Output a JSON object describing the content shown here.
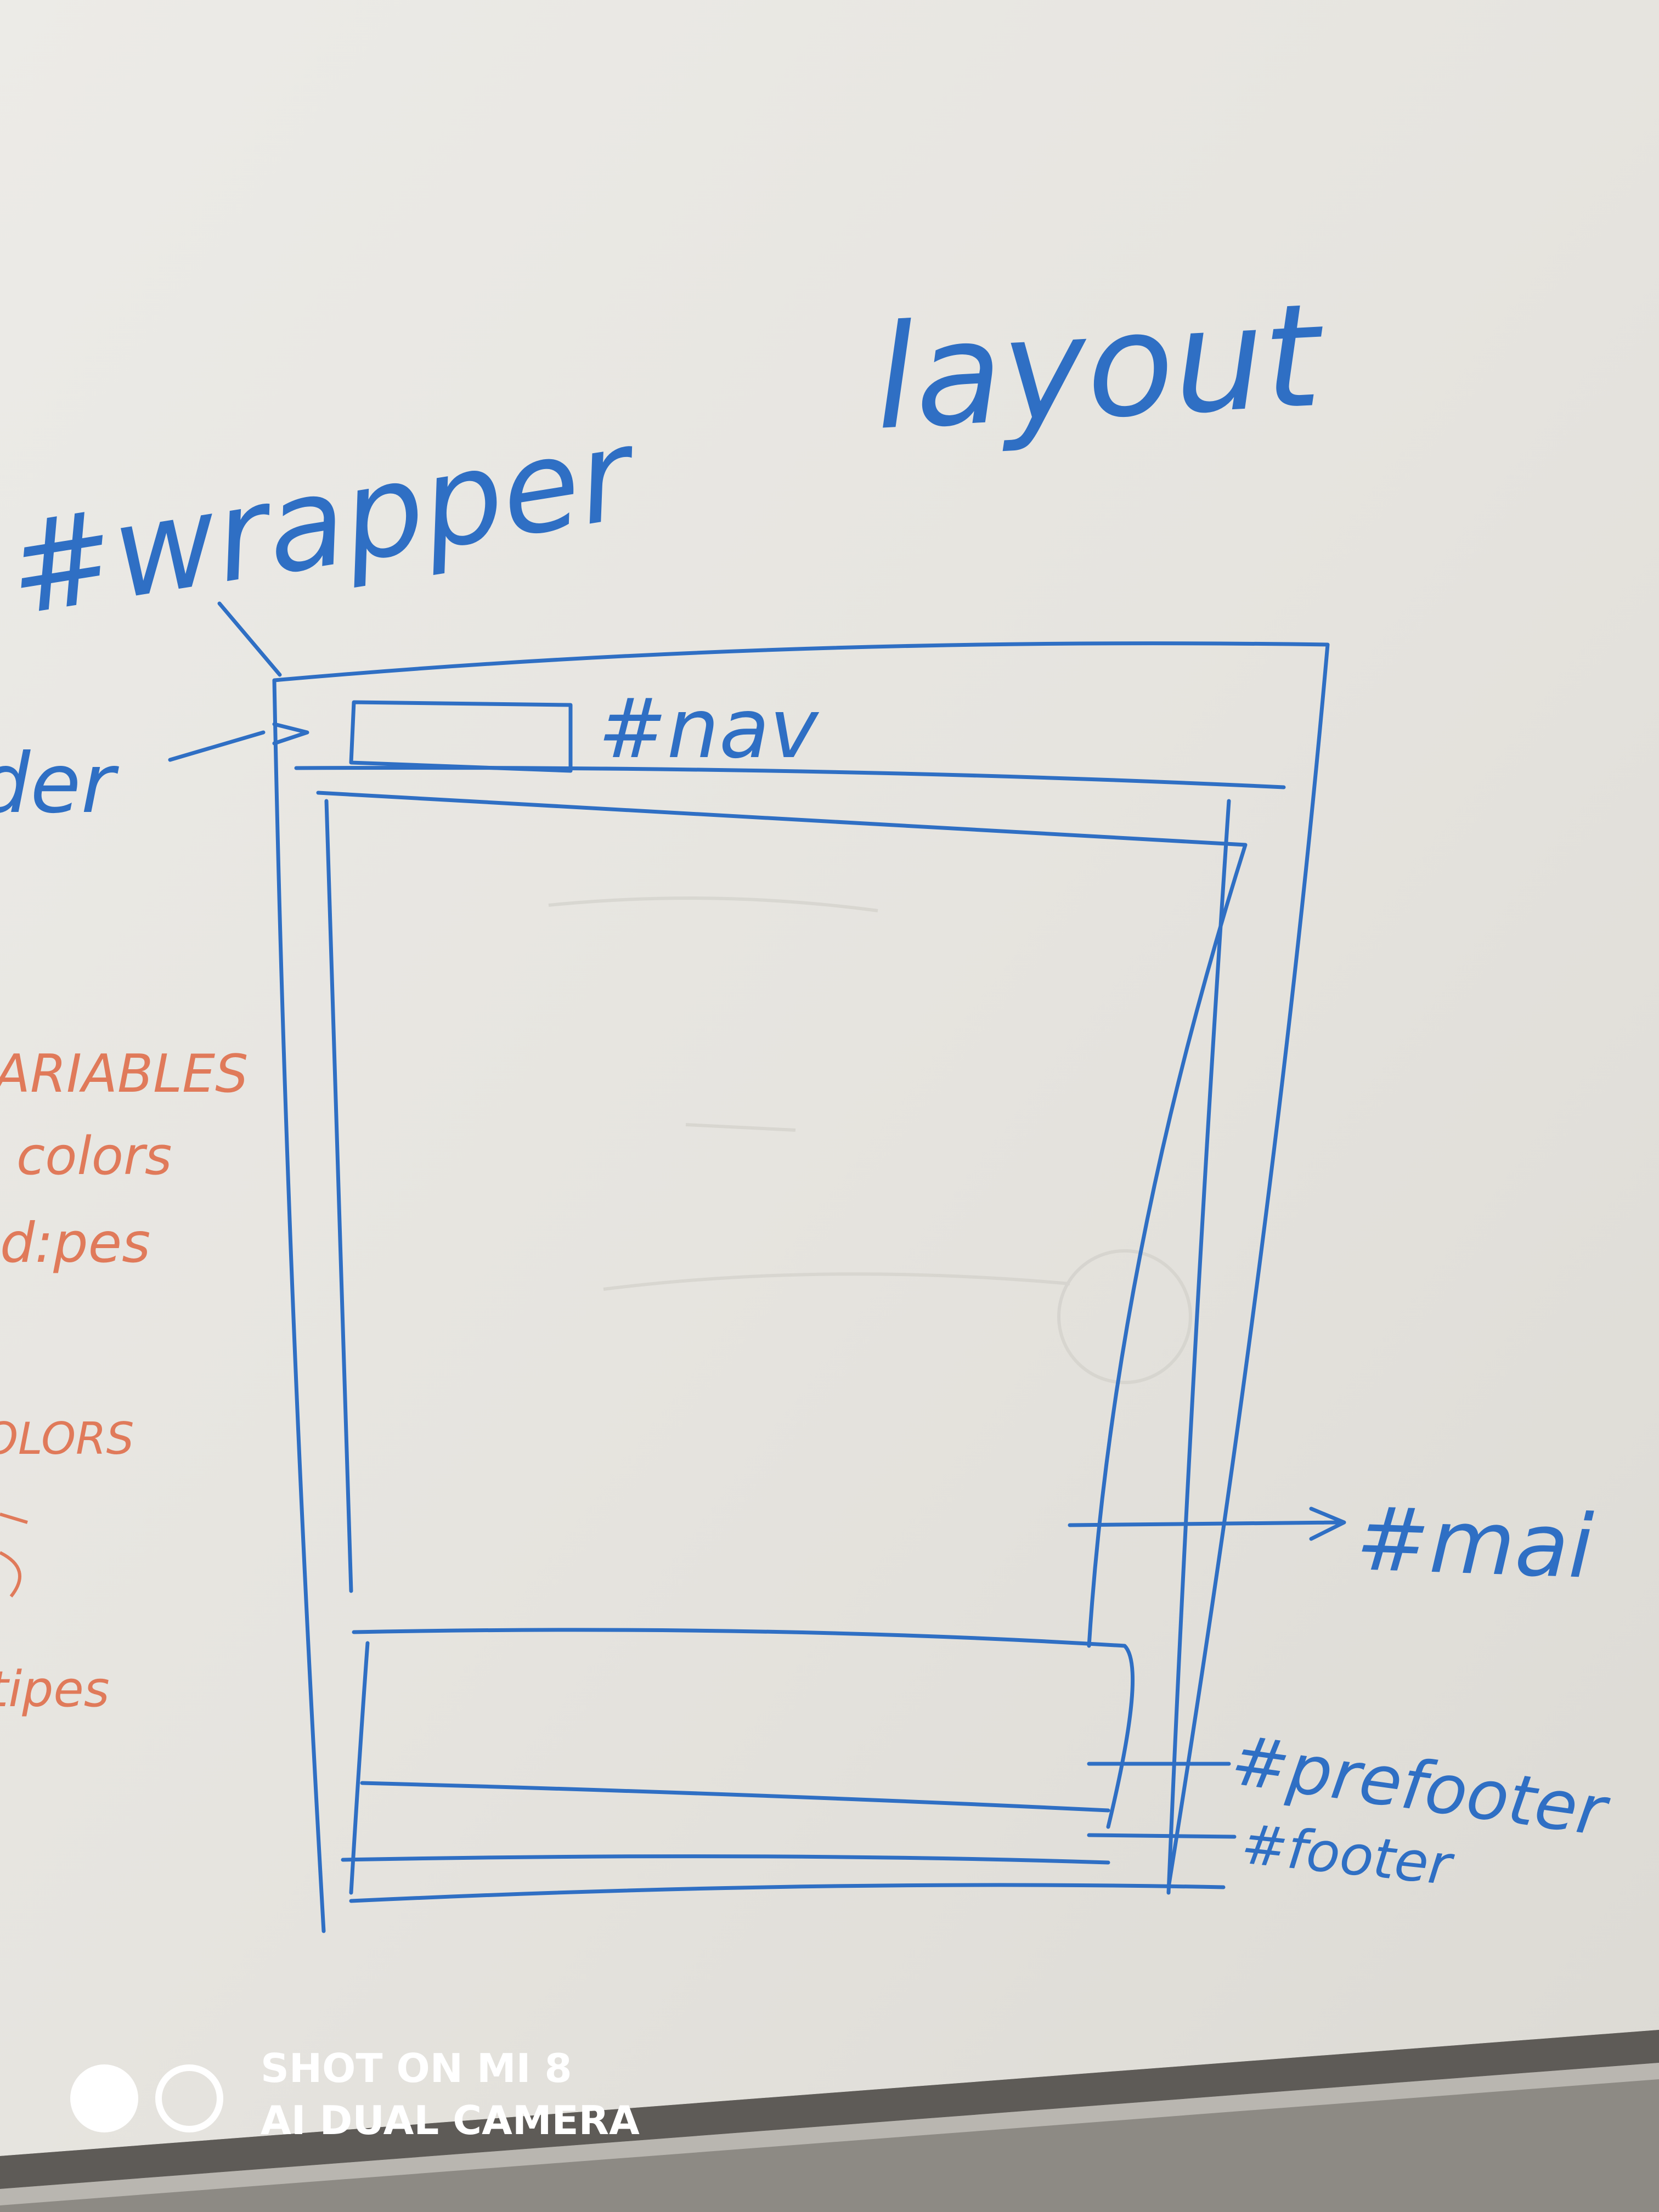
{
  "title_text": "layout",
  "labels": {
    "wrapper": "#wrapper",
    "header_partial": "der",
    "nav": "#nav",
    "main": "#mai",
    "prefooter": "#prefooter",
    "footer": "#footer"
  },
  "orange_notes": [
    "ARIABLES",
    "colors",
    "d:pes",
    "OLORS",
    "tipes"
  ],
  "watermark": {
    "line1": "SHOT ON MI 8",
    "line2": "AI DUAL CAMERA"
  },
  "colors": {
    "board": "#e9e7e2",
    "marker_blue": "#2f6fc4",
    "marker_orange": "#e07a5a",
    "floor": "#8d8a84",
    "tray": "#5e5b57"
  }
}
